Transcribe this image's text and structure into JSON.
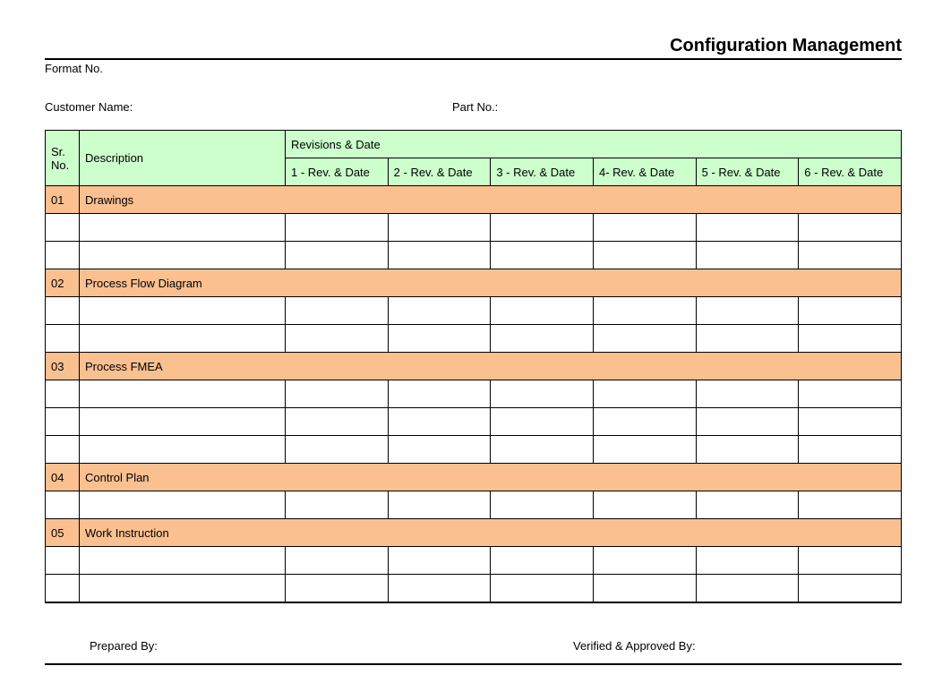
{
  "title": "Configuration Management",
  "formatNoLabel": "Format No.",
  "customerNameLabel": "Customer Name:",
  "partNoLabel": "Part No.:",
  "headers": {
    "srNo": "Sr. No.",
    "description": "Description",
    "revisionsDate": "Revisions & Date",
    "revCols": [
      "1 - Rev. & Date",
      "2 - Rev. & Date",
      "3 - Rev. & Date",
      "4- Rev. & Date",
      "5 - Rev. & Date",
      "6 - Rev. & Date"
    ]
  },
  "sections": [
    {
      "no": "01",
      "desc": "Drawings",
      "blankRows": 2
    },
    {
      "no": "02",
      "desc": "Process Flow Diagram",
      "blankRows": 2
    },
    {
      "no": "03",
      "desc": "Process FMEA",
      "blankRows": 3
    },
    {
      "no": "04",
      "desc": "Control Plan",
      "blankRows": 1
    },
    {
      "no": "05",
      "desc": "Work Instruction",
      "blankRows": 2
    }
  ],
  "footer": {
    "preparedBy": "Prepared By:",
    "verifiedBy": "Verified & Approved By:"
  }
}
